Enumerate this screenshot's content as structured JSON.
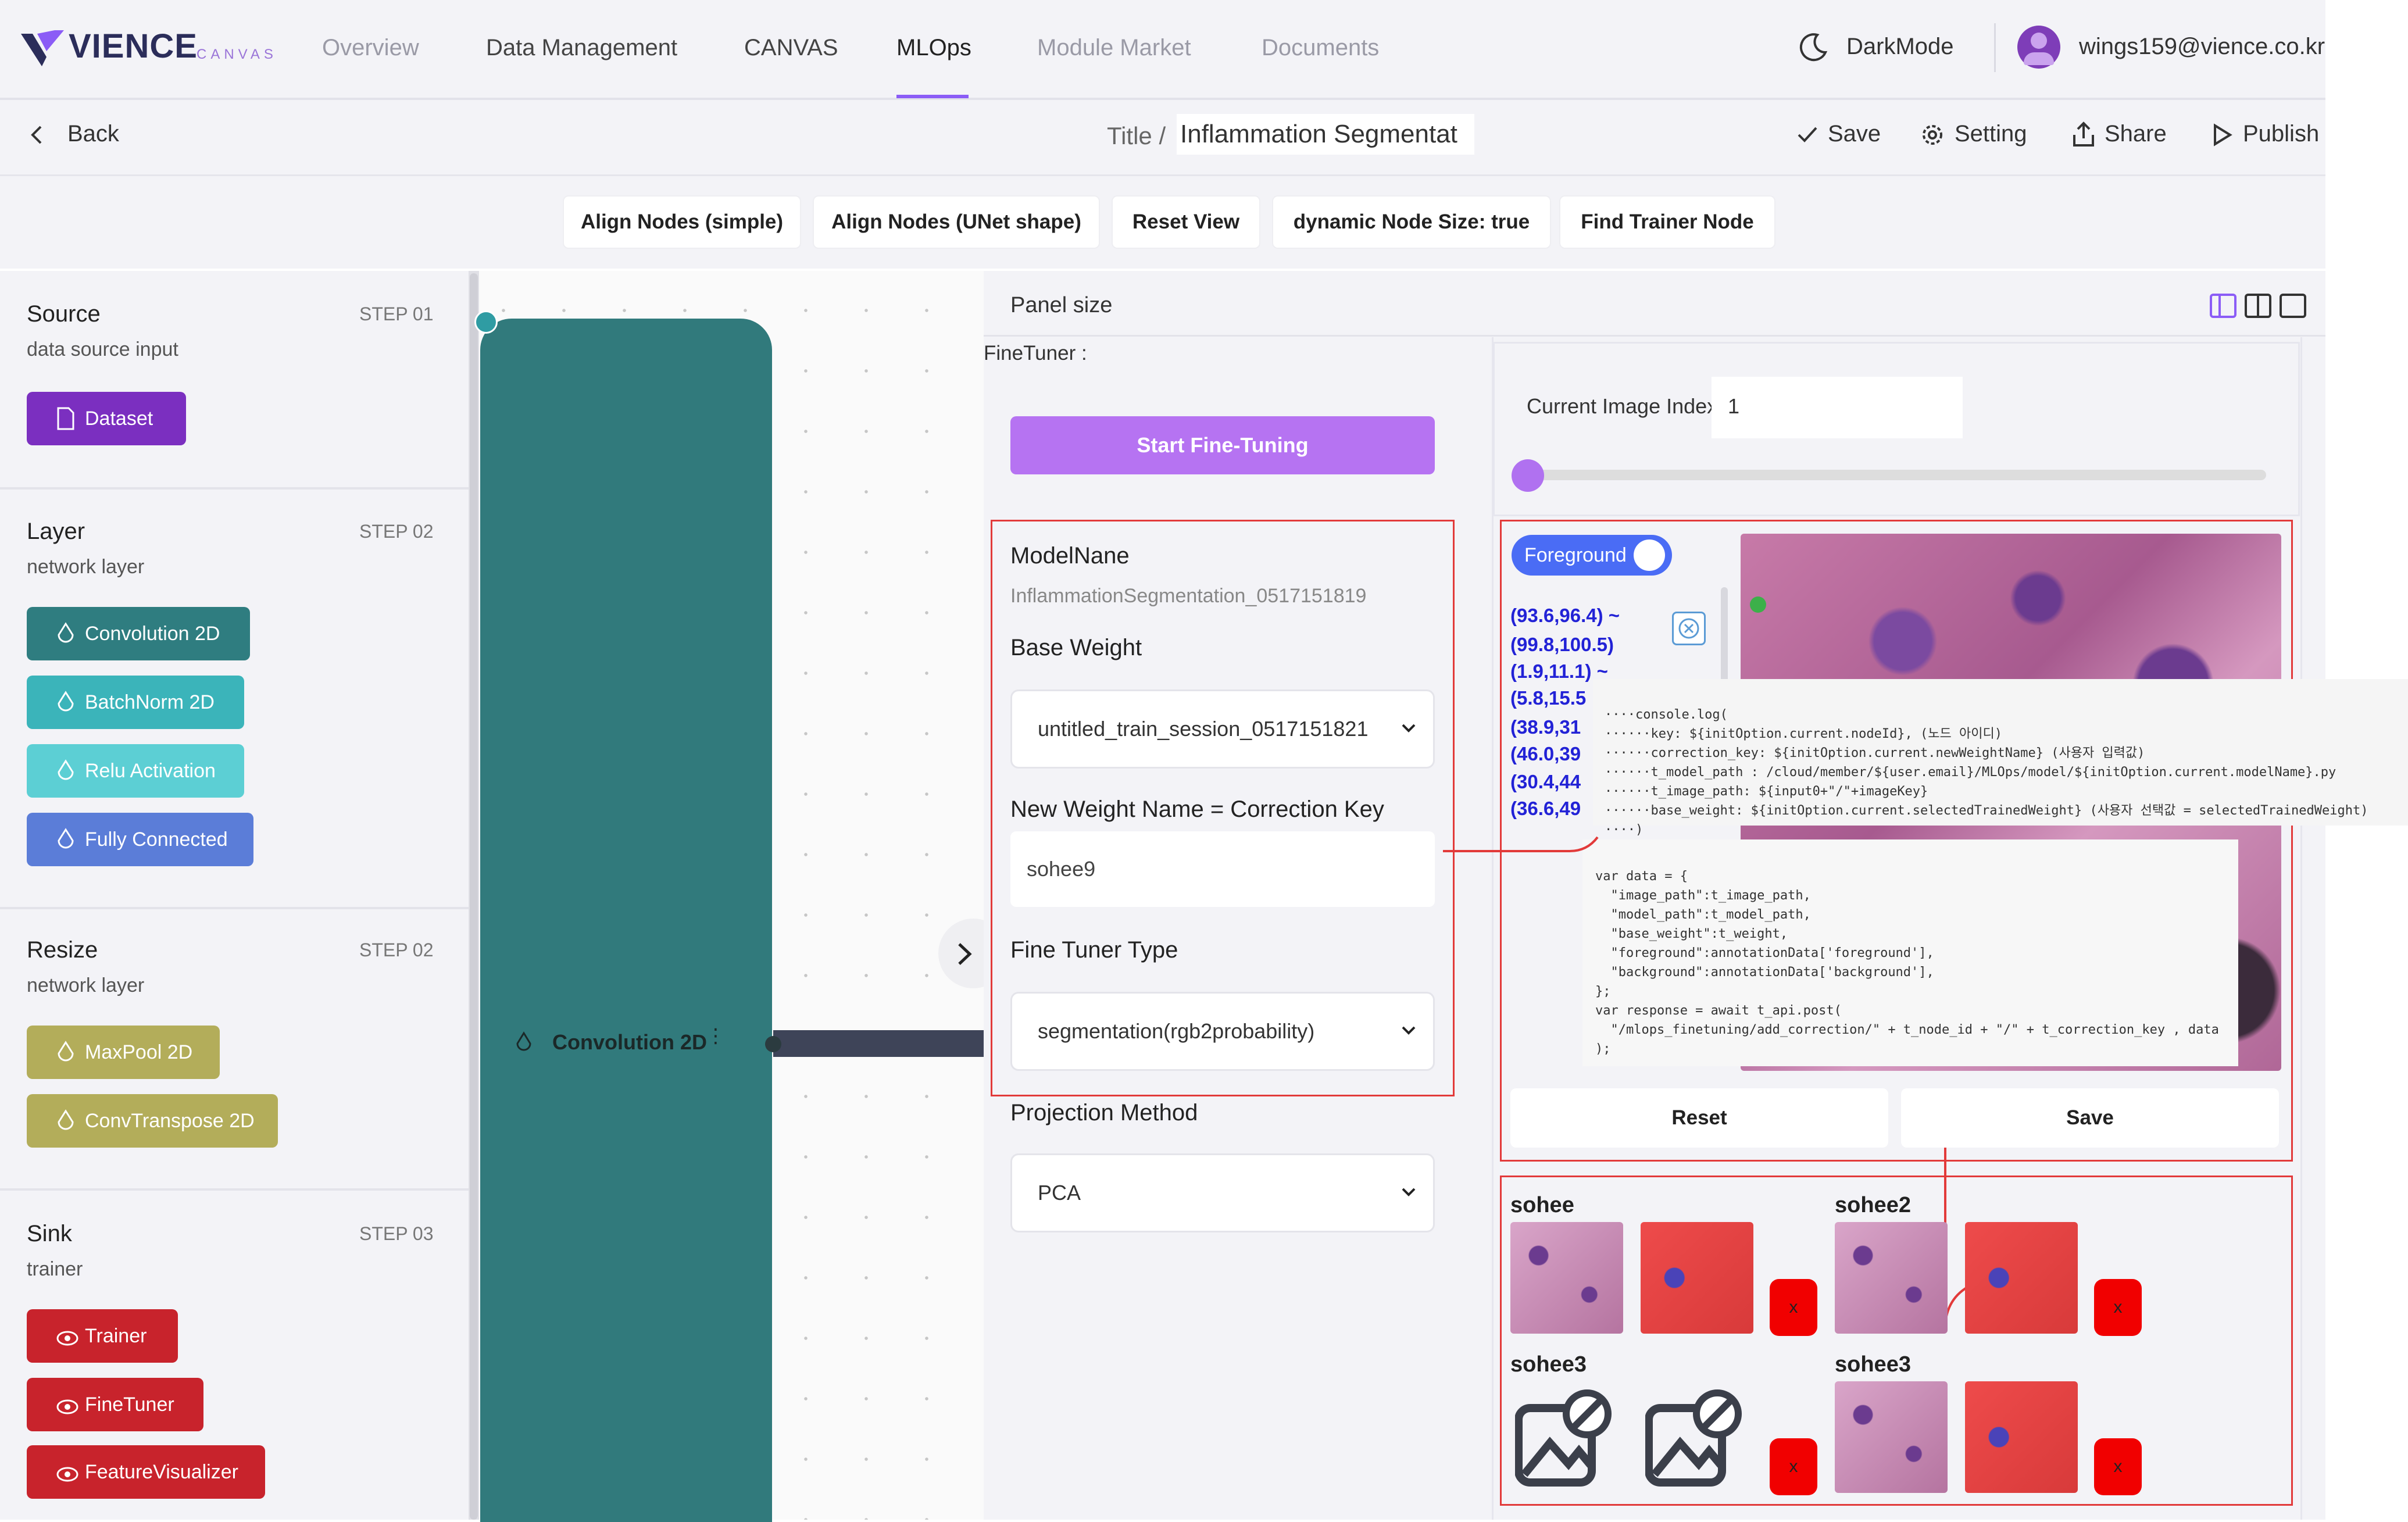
{
  "app": {
    "logo": "VIENCE",
    "logo_sub": "CANVAS",
    "nav": [
      {
        "label": "Overview",
        "state": "dim"
      },
      {
        "label": "Data Management",
        "state": "normal"
      },
      {
        "label": "CANVAS",
        "state": "normal"
      },
      {
        "label": "MLOps",
        "state": "active"
      },
      {
        "label": "Module Market",
        "state": "dim"
      },
      {
        "label": "Documents",
        "state": "dim"
      }
    ],
    "darkmode_label": "DarkMode",
    "user_email": "wings159@vience.co.kr",
    "accent_color": "#8b5cf6"
  },
  "toolbar": {
    "back_label": "Back",
    "title_prefix": "Title /",
    "title_value": "Inflammation Segmentat",
    "save_label": "Save",
    "setting_label": "Setting",
    "share_label": "Share",
    "publish_label": "Publish"
  },
  "canvas_actions": [
    "Align Nodes (simple)",
    "Align Nodes (UNet shape)",
    "Reset View",
    "dynamic Node Size: true",
    "Find Trainer Node"
  ],
  "sidebar": {
    "sections": [
      {
        "title": "Source",
        "step": "STEP 01",
        "sub": "data source input",
        "nodes": [
          {
            "label": "Dataset",
            "color": "#7b2fc0",
            "icon": "file-icon"
          }
        ]
      },
      {
        "title": "Layer",
        "step": "STEP 02",
        "sub": "network layer",
        "nodes": [
          {
            "label": "Convolution 2D",
            "color": "#2f7d80",
            "icon": "drop-icon"
          },
          {
            "label": "BatchNorm 2D",
            "color": "#3bb4ba",
            "icon": "drop-icon"
          },
          {
            "label": "Relu Activation",
            "color": "#5ccfd4",
            "icon": "drop-icon"
          },
          {
            "label": "Fully Connected",
            "color": "#5b7dd8",
            "icon": "drop-icon"
          }
        ]
      },
      {
        "title": "Resize",
        "step": "STEP 02",
        "sub": "network layer",
        "nodes": [
          {
            "label": "MaxPool 2D",
            "color": "#b3ad5a",
            "icon": "drop-icon"
          },
          {
            "label": "ConvTranspose 2D",
            "color": "#b3ad5a",
            "icon": "drop-icon"
          }
        ]
      },
      {
        "title": "Sink",
        "step": "STEP 03",
        "sub": "trainer",
        "nodes": [
          {
            "label": "Trainer",
            "color": "#c8232c",
            "icon": "eye-icon"
          },
          {
            "label": "FineTuner",
            "color": "#c8232c",
            "icon": "eye-icon"
          },
          {
            "label": "FeatureVisualizer",
            "color": "#c8232c",
            "icon": "eye-icon"
          }
        ]
      }
    ]
  },
  "canvas": {
    "node_label": "Convolution 2D"
  },
  "panel": {
    "panel_size_label": "Panel size",
    "finetuner_label": "FineTuner :",
    "start_button": "Start Fine-Tuning",
    "model_name_label": "ModelNane",
    "model_name_value": "InflammationSegmentation_0517151819",
    "base_weight_label": "Base Weight",
    "base_weight_value": "untitled_train_session_0517151821",
    "new_weight_label": "New Weight Name = Correction Key",
    "new_weight_value": "sohee9",
    "tuner_type_label": "Fine Tuner Type",
    "tuner_type_value": "segmentation(rgb2probability)",
    "projection_label": "Projection Method",
    "projection_value": "PCA"
  },
  "viewer": {
    "image_index_label": "Current Image Index",
    "image_index_value": "1",
    "slider_fraction": 0.0,
    "toggle_label": "Foreground",
    "coords": [
      "(93.6,96.4) ~",
      "(99.8,100.5)",
      "(1.9,11.1) ~",
      "(5.8,15.5",
      "(38.9,31",
      "(46.0,39",
      "(30.4,44",
      "(36.6,49"
    ],
    "reset_label": "Reset",
    "save_label": "Save"
  },
  "code": {
    "top": [
      "····console.log(",
      "······key: ${initOption.current.nodeId}, (노드 아이디)",
      "······correction_key: ${initOption.current.newWeightName} (사용자 입력값)",
      "······t_model_path : /cloud/member/${user.email}/MLOps/model/${initOption.current.modelName}.py",
      "······t_image_path: ${input0+\"/\"+imageKey}",
      "······base_weight: ${initOption.current.selectedTrainedWeight} (사용자 선택값 = selectedTrainedWeight)",
      "····)"
    ],
    "bottom": [
      "var data = {",
      "  \"image_path\":t_image_path,",
      "  \"model_path\":t_model_path,",
      "  \"base_weight\":t_weight,",
      "  \"foreground\":annotationData['foreground'],",
      "  \"background\":annotationData['background'],",
      "};",
      "",
      "var response = await t_api.post(",
      "  \"/mlops_finetuning/add_correction/\" + t_node_id + \"/\" + t_correction_key , data",
      ");"
    ]
  },
  "gallery": [
    {
      "name": "sohee",
      "type": "images",
      "delete": "x"
    },
    {
      "name": "sohee2",
      "type": "images",
      "delete": "x"
    },
    {
      "name": "sohee3",
      "type": "placeholder",
      "delete": "x"
    },
    {
      "name": "sohee3",
      "type": "images",
      "delete": "x"
    }
  ]
}
